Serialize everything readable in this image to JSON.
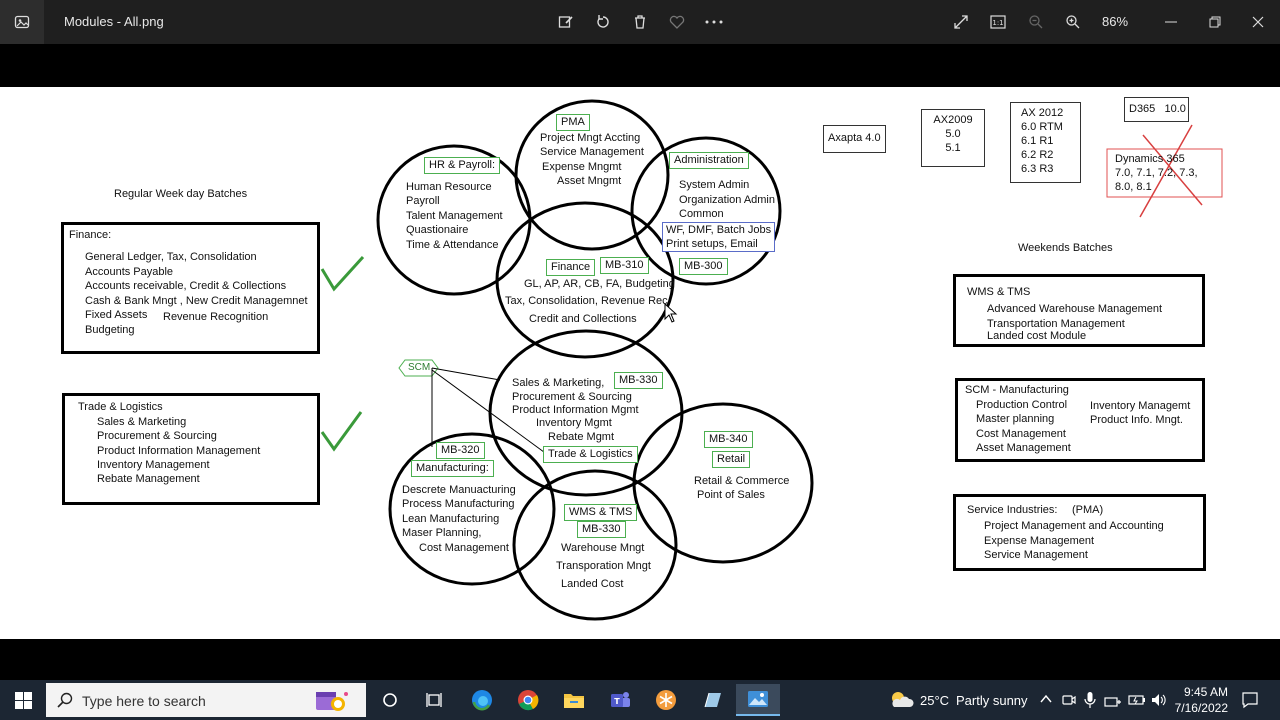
{
  "window": {
    "filename": "Modules - All.png",
    "zoom": "86%"
  },
  "diagram": {
    "regular_batches_label": "Regular Week day Batches",
    "weekend_batches_label": "Weekends Batches",
    "finance_box": {
      "title": "Finance:",
      "lines": [
        "General Ledger, Tax, Consolidation",
        "Accounts Payable",
        "Accounts receivable, Credit & Collections",
        "Cash & Bank Mngt , New Credit Managemnet",
        "Fixed Assets",
        "Budgeting"
      ],
      "extra": "Revenue Recognition"
    },
    "trade_box": {
      "title": "Trade & Logistics",
      "lines": [
        "Sales & Marketing",
        "Procurement & Sourcing",
        "Product Information Management",
        "Inventory Management",
        "Rebate Management"
      ]
    },
    "hr": {
      "tag": "HR & Payroll:",
      "lines": [
        "Human Resource",
        "Payroll",
        "Talent Management",
        "Quastionaire",
        "Time & Attendance"
      ]
    },
    "pma": {
      "tag": "PMA",
      "lines": [
        "Project Mngt Accting",
        "Service Management",
        "Expense Mngmt",
        "Asset Mngmt"
      ]
    },
    "admin": {
      "tag": "Administration",
      "lines": [
        "System Admin",
        "Organization Admin",
        "Common"
      ],
      "box": [
        "WF, DMF, Batch Jobs",
        "Print setups, Email"
      ],
      "exam": "MB-300"
    },
    "finance_circle": {
      "tag": "Finance",
      "exam": "MB-310",
      "lines": [
        "GL, AP, AR, CB, FA, Budgeting",
        "Tax, Consolidation, Revenue Rec",
        "Credit and Collections"
      ]
    },
    "scm_tag": "SCM",
    "sales_circle": {
      "exam": "MB-330",
      "lines": [
        "Sales & Marketing,",
        "Procurement & Sourcing",
        "Product Information Mgmt",
        "Inventory Mgmt",
        "Rebate Mgmt"
      ],
      "tag": "Trade & Logistics"
    },
    "manufacturing": {
      "exam": "MB-320",
      "tag": "Manufacturing:",
      "lines": [
        "Descrete Manuacturing",
        "Process Manufacturing",
        "Lean Manufacturing",
        "Maser Planning,",
        "Cost Management"
      ]
    },
    "wms": {
      "tag": "WMS & TMS",
      "exam": "MB-330",
      "lines": [
        "Warehouse Mngt",
        "Transporation Mngt",
        "Landed Cost"
      ]
    },
    "retail": {
      "exam": "MB-340",
      "tag": "Retail",
      "lines": [
        "Retail & Commerce",
        "Point of Sales"
      ]
    },
    "versions": {
      "axapta": "Axapta 4.0",
      "ax2009": [
        "AX2009",
        "5.0",
        "5.1"
      ],
      "ax2012": [
        "AX 2012",
        "6.0 RTM",
        "6.1  R1",
        "6.2  R2",
        "6.3  R3"
      ],
      "d365": "D365   10.0",
      "dynamics": [
        "Dynamics 365",
        "7.0, 7.1, 7.2, 7.3,",
        "8.0, 8.1"
      ]
    },
    "wms_box": {
      "title": "WMS & TMS",
      "lines": [
        "Advanced Warehouse Management",
        "Transportation Management",
        "Landed cost Module"
      ]
    },
    "scm_mfg_box": {
      "title": "SCM - Manufacturing",
      "lines": [
        "Production Control",
        "Master planning",
        "Cost Management",
        "Asset Management"
      ],
      "right": [
        "Inventory Managemt",
        "Product Info. Mngt."
      ]
    },
    "service_box": {
      "title": "Service Industries:",
      "tag": "(PMA)",
      "lines": [
        "Project Management and Accounting",
        "Expense Management",
        "Service Management"
      ]
    }
  },
  "taskbar": {
    "search_placeholder": "Type here to search",
    "temperature": "25°C",
    "weather": "Partly sunny",
    "time": "9:45 AM",
    "date": "7/16/2022"
  }
}
